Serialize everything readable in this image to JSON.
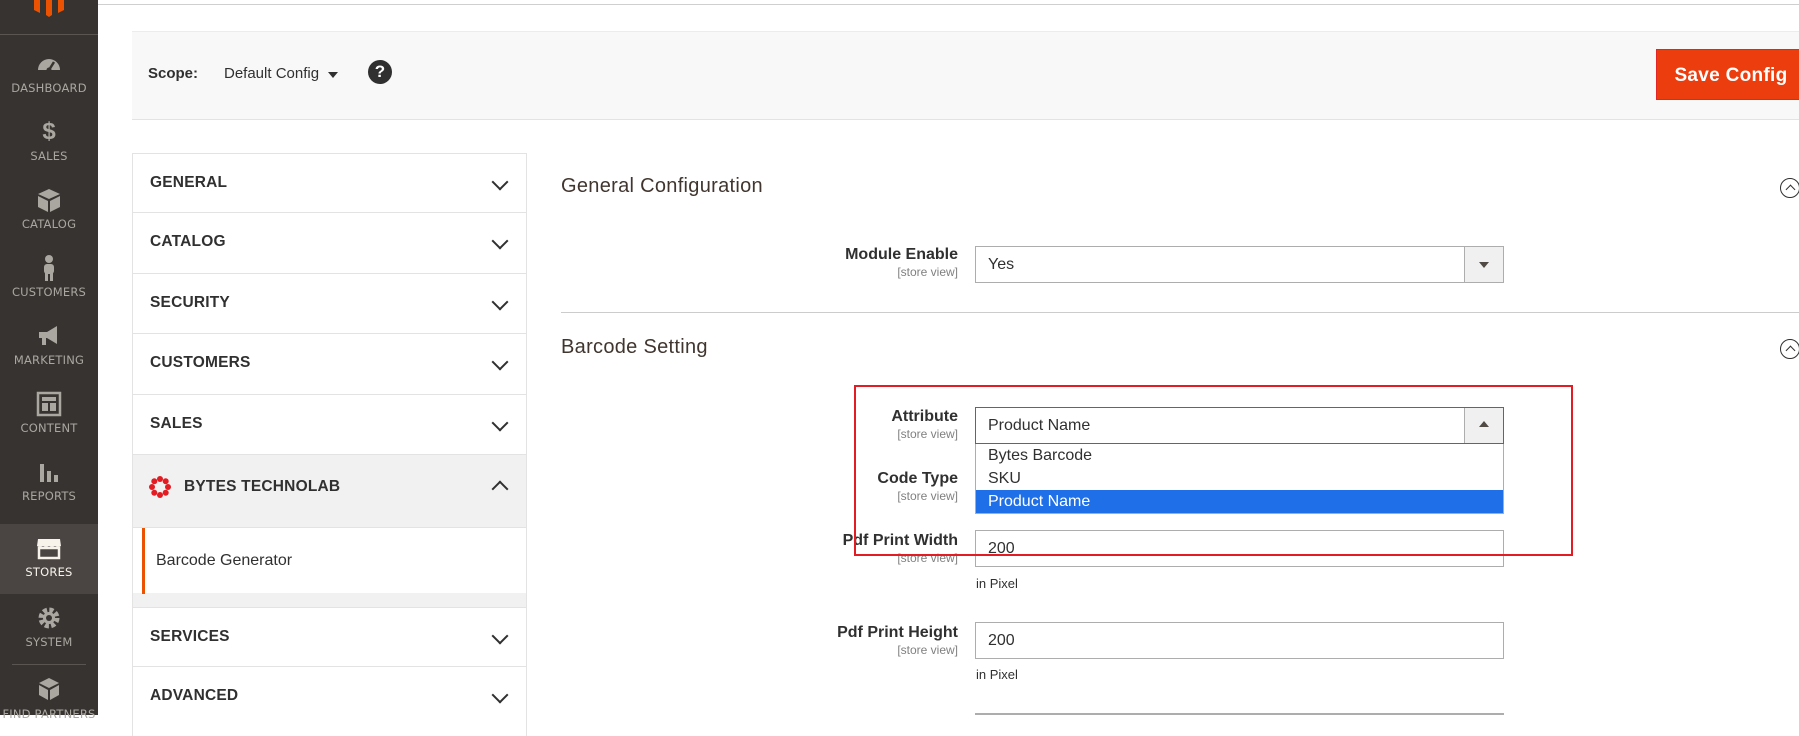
{
  "nav": {
    "items": [
      {
        "label": "DASHBOARD",
        "icon": "gauge-icon"
      },
      {
        "label": "SALES",
        "icon": "dollar-icon"
      },
      {
        "label": "CATALOG",
        "icon": "box-icon"
      },
      {
        "label": "CUSTOMERS",
        "icon": "person-icon"
      },
      {
        "label": "MARKETING",
        "icon": "megaphone-icon"
      },
      {
        "label": "CONTENT",
        "icon": "layout-icon"
      },
      {
        "label": "REPORTS",
        "icon": "bar-chart-icon"
      },
      {
        "label": "STORES",
        "icon": "store-icon"
      },
      {
        "label": "SYSTEM",
        "icon": "gear-icon"
      },
      {
        "label": "FIND PARTNERS",
        "icon": "boxes-icon"
      }
    ],
    "active": "STORES"
  },
  "scope": {
    "label": "Scope:",
    "value": "Default Config",
    "help": "?"
  },
  "save_button": "Save Config",
  "tabs": {
    "general": "GENERAL",
    "catalog": "CATALOG",
    "security": "SECURITY",
    "customers": "CUSTOMERS",
    "sales": "SALES",
    "bytes": "BYTES TECHNOLAB",
    "barcode_generator": "Barcode Generator",
    "services": "SERVICES",
    "advanced": "ADVANCED"
  },
  "sections": {
    "general_configuration": "General Configuration",
    "barcode_setting": "Barcode Setting"
  },
  "fields": {
    "module_enable": {
      "label": "Module Enable",
      "scope": "[store view]",
      "value": "Yes"
    },
    "attribute": {
      "label": "Attribute",
      "scope": "[store view]",
      "value": "Product Name",
      "options": [
        "Bytes Barcode",
        "SKU",
        "Product Name"
      ]
    },
    "code_type": {
      "label": "Code Type",
      "scope": "[store view]"
    },
    "pdf_print_width": {
      "label": "Pdf Print Width",
      "scope": "[store view]",
      "value": "200",
      "note": "in Pixel"
    },
    "pdf_print_height": {
      "label": "Pdf Print Height",
      "scope": "[store view]",
      "value": "200",
      "note": "in Pixel"
    }
  },
  "colors": {
    "nav_bg": "#373330",
    "save_bg": "#eb3d0e",
    "highlight": "#e31b23",
    "selected_option": "#1e6fe8",
    "tab_accent": "#eb5202"
  }
}
